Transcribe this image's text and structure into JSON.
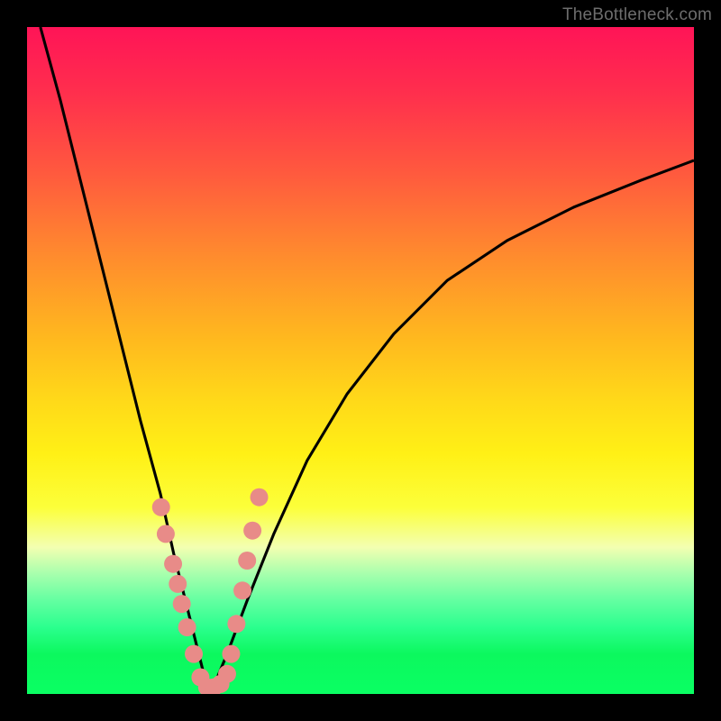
{
  "watermark": "TheBottleneck.com",
  "chart_data": {
    "type": "line",
    "title": "",
    "xlabel": "",
    "ylabel": "",
    "xlim": [
      0,
      100
    ],
    "ylim": [
      0,
      100
    ],
    "background_gradient": {
      "top": "#ff1457",
      "mid": "#ffd919",
      "bottom": "#0aff63"
    },
    "series": [
      {
        "name": "bottleneck-curve-left",
        "x": [
          2,
          5,
          8,
          11,
          14,
          17,
          20,
          22,
          24,
          25.5,
          26.5,
          27.5
        ],
        "y": [
          100,
          89,
          77,
          65,
          53,
          41,
          30,
          21,
          13,
          7,
          3,
          0
        ]
      },
      {
        "name": "bottleneck-curve-right",
        "x": [
          27.5,
          30,
          33,
          37,
          42,
          48,
          55,
          63,
          72,
          82,
          92,
          100
        ],
        "y": [
          0,
          6,
          14,
          24,
          35,
          45,
          54,
          62,
          68,
          73,
          77,
          80
        ]
      },
      {
        "name": "data-points",
        "marker": true,
        "color": "#e88b88",
        "x": [
          20.1,
          20.8,
          21.9,
          22.6,
          23.2,
          24.0,
          25.0,
          26.0,
          27.0,
          28.0,
          29.0,
          30.0,
          30.6,
          31.4,
          32.3,
          33.0,
          33.8,
          34.8
        ],
        "y": [
          28.0,
          24.0,
          19.5,
          16.5,
          13.5,
          10.0,
          6.0,
          2.5,
          1.0,
          1.0,
          1.5,
          3.0,
          6.0,
          10.5,
          15.5,
          20.0,
          24.5,
          29.5
        ]
      }
    ]
  }
}
